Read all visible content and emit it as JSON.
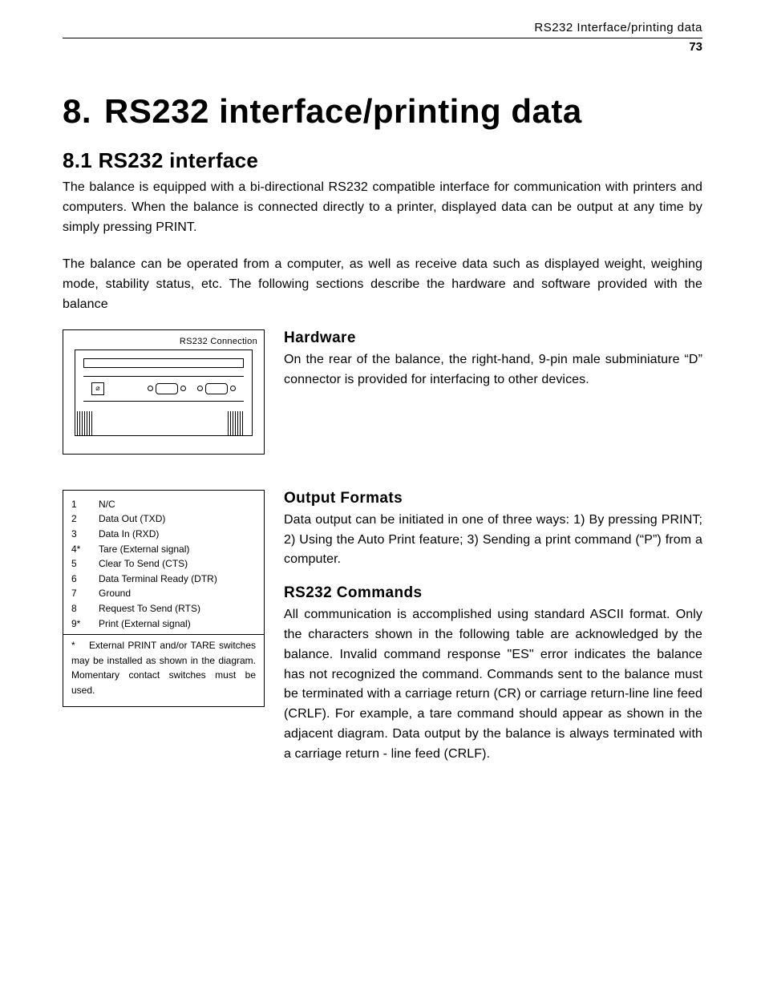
{
  "header": {
    "running": "RS232 Interface/printing data",
    "page_number": "73"
  },
  "chapter": {
    "number": "8.",
    "title": "RS232 interface/printing data"
  },
  "section": {
    "number": "8.1",
    "title": "RS232 interface"
  },
  "intro1": "The balance is equipped with a bi-directional RS232 compatible interface for communication with printers and computers. When the balance is connected directly to a printer, displayed data can be output at any time by simply pressing PRINT.",
  "intro2": "The balance can be operated from a computer, as well as receive data such as displayed weight, weighing mode, stability status, etc. The following sections describe the hardware and software provided with the balance",
  "diagram_label": "RS232 Connection",
  "hardware": {
    "heading": "Hardware",
    "body": "On the rear of the balance, the right-hand, 9-pin male subminiature “D” connector is provided for interfacing to other devices."
  },
  "output_formats": {
    "heading": "Output Formats",
    "body": "Data output can be initiated in one of three ways: 1) By pressing PRINT; 2) Using the Auto Print feature; 3) Sending a print command (“P”) from a computer."
  },
  "rs232_commands": {
    "heading": "RS232 Commands",
    "body": "All communication is accomplished using standard ASCII format. Only the characters shown in the following table are acknowledged by the balance. Invalid command response \"ES\" error indicates the balance has not recognized the command. Commands sent to the balance must be terminated with a carriage return (CR) or carriage return-line line feed (CRLF). For example, a tare command should appear as shown in the adjacent diagram. Data output by the balance is always terminated with a carriage return - line feed (CRLF)."
  },
  "pins": [
    {
      "num": "1",
      "label": "N/C"
    },
    {
      "num": "2",
      "label": "Data Out (TXD)"
    },
    {
      "num": "3",
      "label": "Data In (RXD)"
    },
    {
      "num": "4*",
      "label": "Tare (External signal)"
    },
    {
      "num": "5",
      "label": "Clear To Send (CTS)"
    },
    {
      "num": "6",
      "label": "Data Terminal Ready (DTR)"
    },
    {
      "num": "7",
      "label": "Ground"
    },
    {
      "num": "8",
      "label": "Request To Send (RTS)"
    },
    {
      "num": "9*",
      "label": "Print (External signal)"
    }
  ],
  "pin_note_star": "*",
  "pin_note": "External PRINT and/or TARE switches may be installed as shown in the diagram. Momentary contact switches must be used."
}
